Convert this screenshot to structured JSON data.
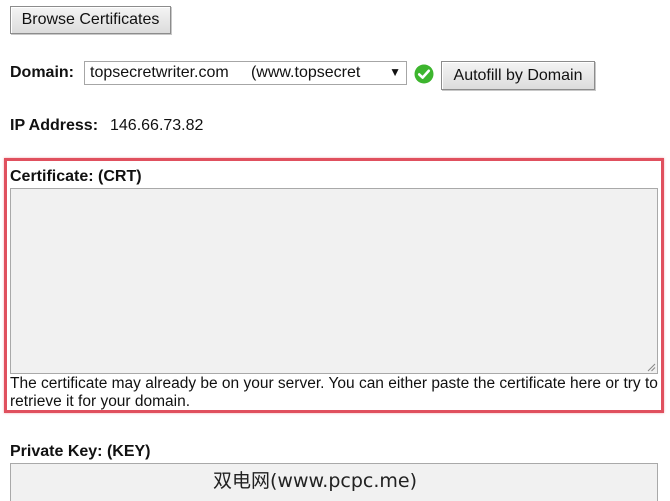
{
  "toolbar": {
    "browse_label": "Browse Certificates"
  },
  "domain": {
    "label": "Domain:",
    "selected": "topsecretwriter.com     (www.topsecret",
    "check_icon": "green-check-icon",
    "autofill_label": "Autofill by Domain"
  },
  "ip": {
    "label": "IP Address:",
    "value": "146.66.73.82"
  },
  "certificate": {
    "label": "Certificate: (CRT)",
    "value": "",
    "help": "The certificate may already be on your server. You can either paste the certificate here or try to retrieve it for your domain.",
    "highlight_color": "#e0505e"
  },
  "private_key": {
    "label": "Private Key: (KEY)",
    "value": ""
  },
  "watermark": "双电网(www.pcpc.me)"
}
